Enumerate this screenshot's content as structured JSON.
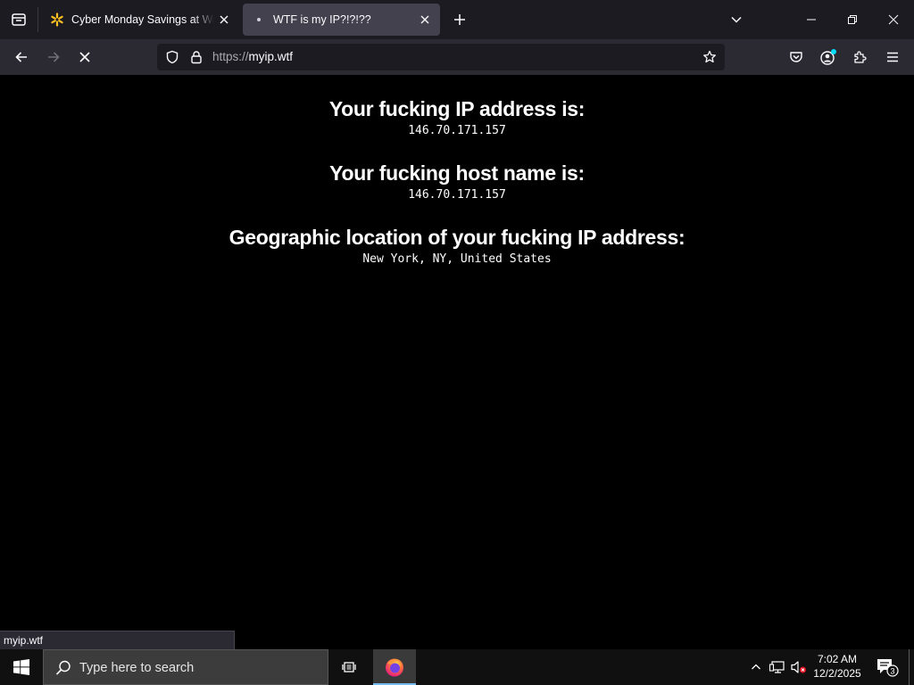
{
  "browser": {
    "tabs": [
      {
        "title": "Cyber Monday Savings at Walmart",
        "favicon": "walmart-spark-icon",
        "active": false
      },
      {
        "title": "WTF is my IP?!?!??",
        "favicon": "dot-favicon-icon",
        "active": true
      }
    ],
    "url": {
      "scheme": "https://",
      "host": "myip.wtf"
    },
    "status_text": "myip.wtf",
    "colors": {
      "tab_strip": "#1c1b22",
      "toolbar": "#2b2a33",
      "urlbar": "#1c1b22",
      "active_tab": "#42414d",
      "accent_walmart": "#ffc220",
      "account_dot": "#00ddff"
    }
  },
  "page": {
    "sections": [
      {
        "heading": "Your fucking IP address is:",
        "value": "146.70.171.157"
      },
      {
        "heading": "Your fucking host name is:",
        "value": "146.70.171.157"
      },
      {
        "heading": "Geographic location of your fucking IP address:",
        "value": "New York, NY, United States"
      }
    ]
  },
  "taskbar": {
    "search_placeholder": "Type here to search",
    "time": "7:02 AM",
    "date": "12/2/2025",
    "notification_count": "3",
    "pinned": [
      "firefox-icon"
    ]
  }
}
